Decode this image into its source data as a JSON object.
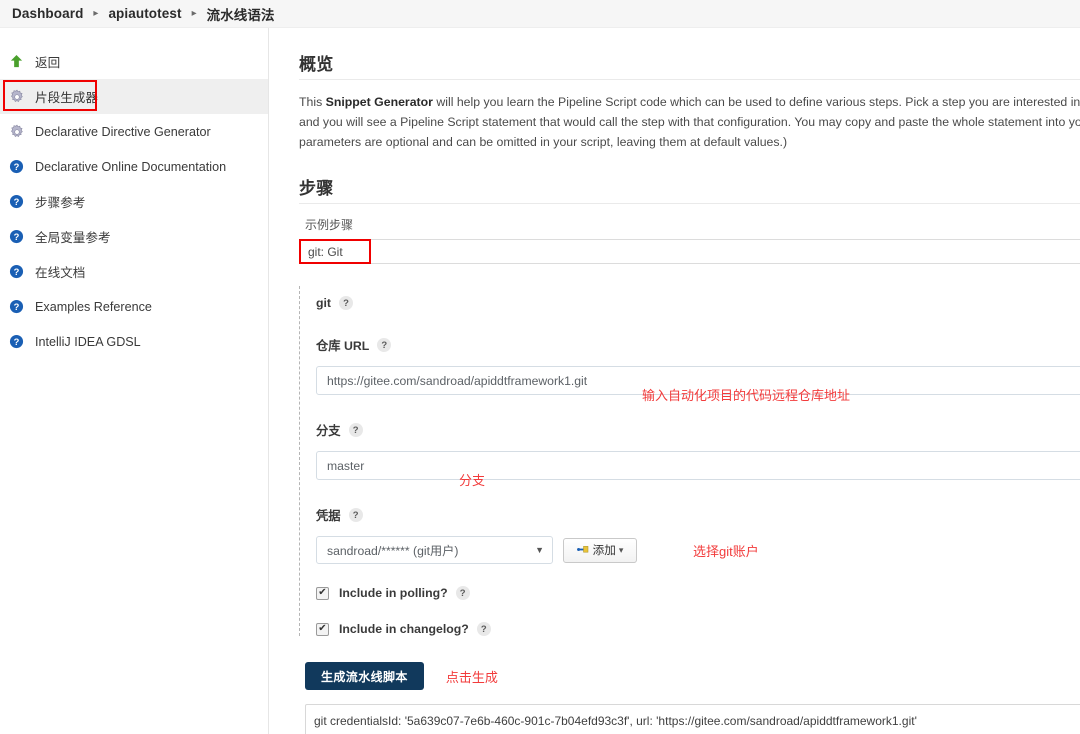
{
  "breadcrumb": {
    "items": [
      {
        "label": "Dashboard"
      },
      {
        "label": "apiautotest"
      },
      {
        "label": "流水线语法"
      }
    ],
    "separator": "▸"
  },
  "sidebar": {
    "items": [
      {
        "label": "返回",
        "icon": "up-arrow-icon"
      },
      {
        "label": "片段生成器",
        "icon": "gear-icon",
        "selected": true
      },
      {
        "label": "Declarative Directive Generator",
        "icon": "gear-icon"
      },
      {
        "label": "Declarative Online Documentation",
        "icon": "help-icon"
      },
      {
        "label": "步骤参考",
        "icon": "help-icon"
      },
      {
        "label": "全局变量参考",
        "icon": "help-icon"
      },
      {
        "label": "在线文档",
        "icon": "help-icon"
      },
      {
        "label": "Examples Reference",
        "icon": "help-icon"
      },
      {
        "label": "IntelliJ IDEA GDSL",
        "icon": "help-icon"
      }
    ]
  },
  "main": {
    "overview_title": "概览",
    "intro_prefix": "This ",
    "intro_bold": "Snippet Generator",
    "intro_rest": " will help you learn the Pipeline Script code which can be used to define various steps. Pick a step you are interested in from the list, configure it, click Generate Pipeline Script, and you will see a Pipeline Script statement that would call the step with that configuration. You may copy and paste the whole statement into your script, or pick up just the options you care about. (Most parameters are optional and can be omitted in your script, leaving them at default values.)",
    "steps_title": "步骤",
    "sample_step_label": "示例步骤",
    "step_select_value": "git: Git",
    "form": {
      "group_label": "git",
      "help_glyph": "?",
      "repo_url_label": "仓库 URL",
      "repo_url_value": "https://gitee.com/sandroad/apiddtframework1.git",
      "branch_label": "分支",
      "branch_value": "master",
      "credentials_label": "凭据",
      "credentials_value": "sandroad/****** (git用户)",
      "add_button_label": "添加",
      "add_button_caret": "▾",
      "select_caret": "▼",
      "checkbox_glyph": "✔",
      "polling_label": "Include in polling?",
      "changelog_label": "Include in changelog?"
    },
    "generate_button_label": "生成流水线脚本",
    "output_text": "git credentialsId: '5a639c07-7e6b-460c-901c-7b04efd93c3f', url: 'https://gitee.com/sandroad/apiddtframework1.git'"
  },
  "annotations": {
    "repo_url_note": "输入自动化项目的代码远程仓库地址",
    "branch_note": "分支",
    "credentials_note": "选择git账户",
    "generate_note": "点击生成",
    "box_color": "#f00000",
    "note_color": "#f23b3b"
  }
}
